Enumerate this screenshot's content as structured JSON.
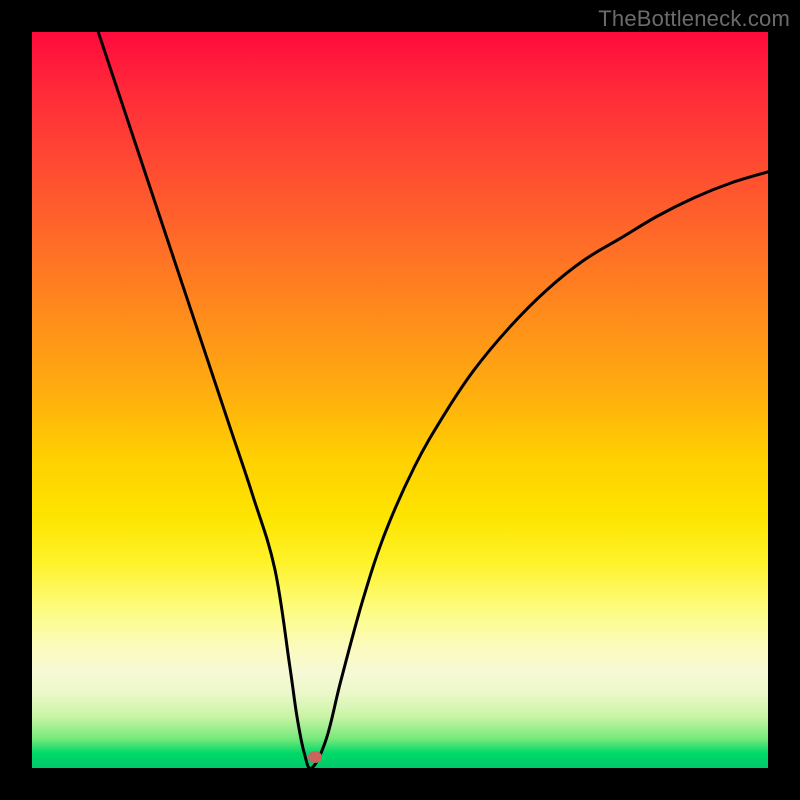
{
  "watermark": "TheBottleneck.com",
  "colors": {
    "frame": "#000000",
    "curve_stroke": "#000000",
    "marker": "#c9655c",
    "gradient_top": "#ff0a3c",
    "gradient_bottom": "#00c96a"
  },
  "chart_data": {
    "type": "line",
    "title": "",
    "xlabel": "",
    "ylabel": "",
    "xlim": [
      0,
      100
    ],
    "ylim": [
      0,
      100
    ],
    "grid": false,
    "legend": false,
    "series": [
      {
        "name": "bottleneck-curve",
        "x": [
          9,
          12,
          15,
          18,
          21,
          24,
          27,
          30,
          33,
          35,
          36,
          37,
          38,
          40,
          42,
          45,
          48,
          52,
          56,
          60,
          65,
          70,
          75,
          80,
          85,
          90,
          95,
          100
        ],
        "y": [
          100,
          91,
          82,
          73,
          64,
          55,
          46,
          37,
          27,
          14,
          7,
          2,
          0,
          4,
          12,
          23,
          32,
          41,
          48,
          54,
          60,
          65,
          69,
          72,
          75,
          77.5,
          79.5,
          81
        ]
      }
    ],
    "marker": {
      "x": 38.5,
      "y": 1.5
    },
    "background_gradient": {
      "orientation": "vertical",
      "stops": [
        {
          "pos": 0.0,
          "color": "#ff0a3c"
        },
        {
          "pos": 0.48,
          "color": "#ffaa10"
        },
        {
          "pos": 0.72,
          "color": "#fff22a"
        },
        {
          "pos": 0.9,
          "color": "#eaf8c8"
        },
        {
          "pos": 1.0,
          "color": "#00c96a"
        }
      ]
    }
  }
}
